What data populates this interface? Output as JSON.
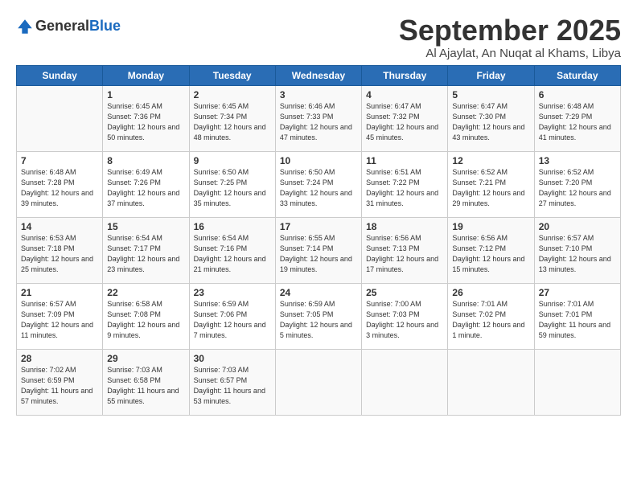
{
  "logo": {
    "general": "General",
    "blue": "Blue"
  },
  "header": {
    "month": "September 2025",
    "location": "Al Ajaylat, An Nuqat al Khams, Libya"
  },
  "weekdays": [
    "Sunday",
    "Monday",
    "Tuesday",
    "Wednesday",
    "Thursday",
    "Friday",
    "Saturday"
  ],
  "weeks": [
    [
      {
        "day": "",
        "sunrise": "",
        "sunset": "",
        "daylight": ""
      },
      {
        "day": "1",
        "sunrise": "Sunrise: 6:45 AM",
        "sunset": "Sunset: 7:36 PM",
        "daylight": "Daylight: 12 hours and 50 minutes."
      },
      {
        "day": "2",
        "sunrise": "Sunrise: 6:45 AM",
        "sunset": "Sunset: 7:34 PM",
        "daylight": "Daylight: 12 hours and 48 minutes."
      },
      {
        "day": "3",
        "sunrise": "Sunrise: 6:46 AM",
        "sunset": "Sunset: 7:33 PM",
        "daylight": "Daylight: 12 hours and 47 minutes."
      },
      {
        "day": "4",
        "sunrise": "Sunrise: 6:47 AM",
        "sunset": "Sunset: 7:32 PM",
        "daylight": "Daylight: 12 hours and 45 minutes."
      },
      {
        "day": "5",
        "sunrise": "Sunrise: 6:47 AM",
        "sunset": "Sunset: 7:30 PM",
        "daylight": "Daylight: 12 hours and 43 minutes."
      },
      {
        "day": "6",
        "sunrise": "Sunrise: 6:48 AM",
        "sunset": "Sunset: 7:29 PM",
        "daylight": "Daylight: 12 hours and 41 minutes."
      }
    ],
    [
      {
        "day": "7",
        "sunrise": "Sunrise: 6:48 AM",
        "sunset": "Sunset: 7:28 PM",
        "daylight": "Daylight: 12 hours and 39 minutes."
      },
      {
        "day": "8",
        "sunrise": "Sunrise: 6:49 AM",
        "sunset": "Sunset: 7:26 PM",
        "daylight": "Daylight: 12 hours and 37 minutes."
      },
      {
        "day": "9",
        "sunrise": "Sunrise: 6:50 AM",
        "sunset": "Sunset: 7:25 PM",
        "daylight": "Daylight: 12 hours and 35 minutes."
      },
      {
        "day": "10",
        "sunrise": "Sunrise: 6:50 AM",
        "sunset": "Sunset: 7:24 PM",
        "daylight": "Daylight: 12 hours and 33 minutes."
      },
      {
        "day": "11",
        "sunrise": "Sunrise: 6:51 AM",
        "sunset": "Sunset: 7:22 PM",
        "daylight": "Daylight: 12 hours and 31 minutes."
      },
      {
        "day": "12",
        "sunrise": "Sunrise: 6:52 AM",
        "sunset": "Sunset: 7:21 PM",
        "daylight": "Daylight: 12 hours and 29 minutes."
      },
      {
        "day": "13",
        "sunrise": "Sunrise: 6:52 AM",
        "sunset": "Sunset: 7:20 PM",
        "daylight": "Daylight: 12 hours and 27 minutes."
      }
    ],
    [
      {
        "day": "14",
        "sunrise": "Sunrise: 6:53 AM",
        "sunset": "Sunset: 7:18 PM",
        "daylight": "Daylight: 12 hours and 25 minutes."
      },
      {
        "day": "15",
        "sunrise": "Sunrise: 6:54 AM",
        "sunset": "Sunset: 7:17 PM",
        "daylight": "Daylight: 12 hours and 23 minutes."
      },
      {
        "day": "16",
        "sunrise": "Sunrise: 6:54 AM",
        "sunset": "Sunset: 7:16 PM",
        "daylight": "Daylight: 12 hours and 21 minutes."
      },
      {
        "day": "17",
        "sunrise": "Sunrise: 6:55 AM",
        "sunset": "Sunset: 7:14 PM",
        "daylight": "Daylight: 12 hours and 19 minutes."
      },
      {
        "day": "18",
        "sunrise": "Sunrise: 6:56 AM",
        "sunset": "Sunset: 7:13 PM",
        "daylight": "Daylight: 12 hours and 17 minutes."
      },
      {
        "day": "19",
        "sunrise": "Sunrise: 6:56 AM",
        "sunset": "Sunset: 7:12 PM",
        "daylight": "Daylight: 12 hours and 15 minutes."
      },
      {
        "day": "20",
        "sunrise": "Sunrise: 6:57 AM",
        "sunset": "Sunset: 7:10 PM",
        "daylight": "Daylight: 12 hours and 13 minutes."
      }
    ],
    [
      {
        "day": "21",
        "sunrise": "Sunrise: 6:57 AM",
        "sunset": "Sunset: 7:09 PM",
        "daylight": "Daylight: 12 hours and 11 minutes."
      },
      {
        "day": "22",
        "sunrise": "Sunrise: 6:58 AM",
        "sunset": "Sunset: 7:08 PM",
        "daylight": "Daylight: 12 hours and 9 minutes."
      },
      {
        "day": "23",
        "sunrise": "Sunrise: 6:59 AM",
        "sunset": "Sunset: 7:06 PM",
        "daylight": "Daylight: 12 hours and 7 minutes."
      },
      {
        "day": "24",
        "sunrise": "Sunrise: 6:59 AM",
        "sunset": "Sunset: 7:05 PM",
        "daylight": "Daylight: 12 hours and 5 minutes."
      },
      {
        "day": "25",
        "sunrise": "Sunrise: 7:00 AM",
        "sunset": "Sunset: 7:03 PM",
        "daylight": "Daylight: 12 hours and 3 minutes."
      },
      {
        "day": "26",
        "sunrise": "Sunrise: 7:01 AM",
        "sunset": "Sunset: 7:02 PM",
        "daylight": "Daylight: 12 hours and 1 minute."
      },
      {
        "day": "27",
        "sunrise": "Sunrise: 7:01 AM",
        "sunset": "Sunset: 7:01 PM",
        "daylight": "Daylight: 11 hours and 59 minutes."
      }
    ],
    [
      {
        "day": "28",
        "sunrise": "Sunrise: 7:02 AM",
        "sunset": "Sunset: 6:59 PM",
        "daylight": "Daylight: 11 hours and 57 minutes."
      },
      {
        "day": "29",
        "sunrise": "Sunrise: 7:03 AM",
        "sunset": "Sunset: 6:58 PM",
        "daylight": "Daylight: 11 hours and 55 minutes."
      },
      {
        "day": "30",
        "sunrise": "Sunrise: 7:03 AM",
        "sunset": "Sunset: 6:57 PM",
        "daylight": "Daylight: 11 hours and 53 minutes."
      },
      {
        "day": "",
        "sunrise": "",
        "sunset": "",
        "daylight": ""
      },
      {
        "day": "",
        "sunrise": "",
        "sunset": "",
        "daylight": ""
      },
      {
        "day": "",
        "sunrise": "",
        "sunset": "",
        "daylight": ""
      },
      {
        "day": "",
        "sunrise": "",
        "sunset": "",
        "daylight": ""
      }
    ]
  ]
}
